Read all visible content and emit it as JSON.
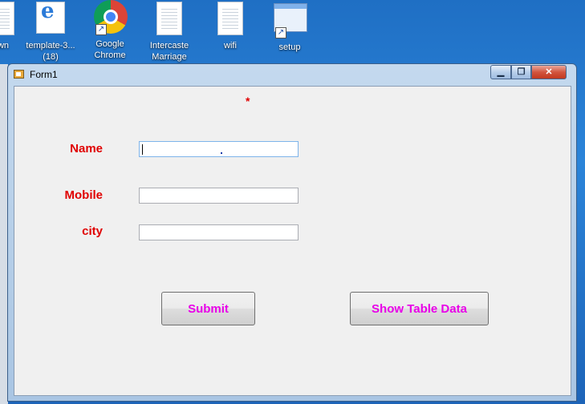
{
  "desktop": {
    "icons": [
      {
        "label": "wn",
        "icon": "partial-document-icon"
      },
      {
        "label": "template-3...\n(18)",
        "icon": "internet-explorer-icon"
      },
      {
        "label": "Google\nChrome",
        "icon": "chrome-icon"
      },
      {
        "label": "Intercaste\nMarriage",
        "icon": "text-document-icon"
      },
      {
        "label": "wifi",
        "icon": "text-document-icon"
      },
      {
        "label": "setup",
        "icon": "application-window-icon"
      }
    ]
  },
  "window": {
    "title": "Form1",
    "controls": {
      "minimize": "▁",
      "maximize": "❐",
      "close": "✕"
    }
  },
  "form": {
    "required_marker": "*",
    "fields": {
      "name": {
        "label": "Name",
        "value": "",
        "placeholder": ""
      },
      "mobile": {
        "label": "Mobile",
        "value": "",
        "placeholder": ""
      },
      "city": {
        "label": "city",
        "value": "",
        "placeholder": ""
      }
    },
    "buttons": {
      "submit": "Submit",
      "show_table": "Show Table Data"
    }
  },
  "colors": {
    "label": "#e00000",
    "button_text": "#e800e8",
    "client_bg": "#f0f0f0"
  }
}
